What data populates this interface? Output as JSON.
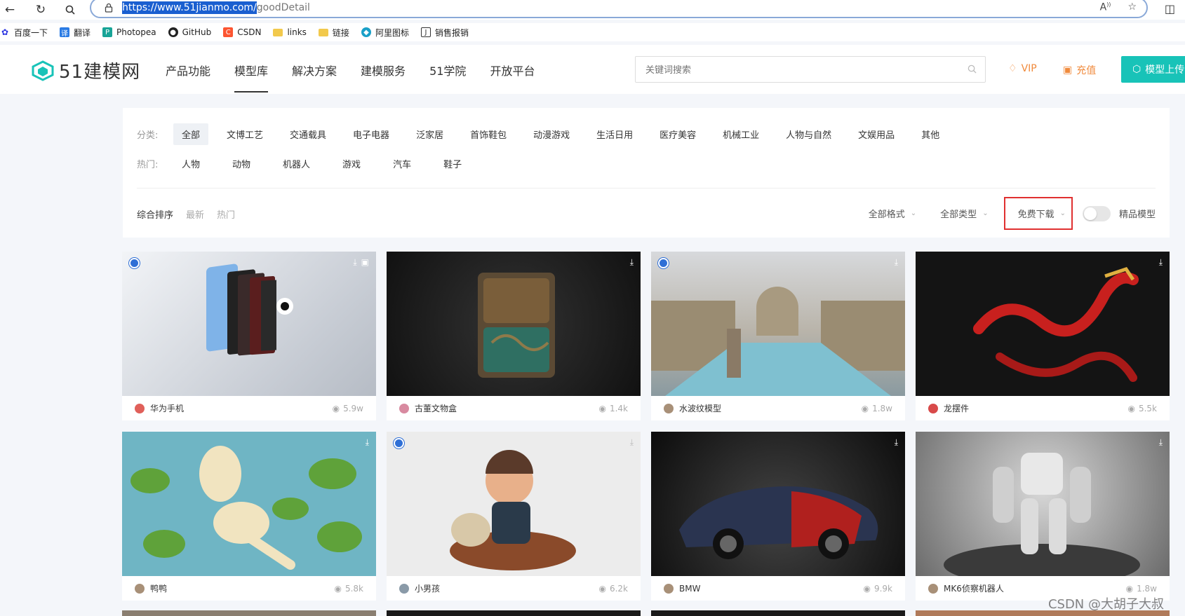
{
  "browser": {
    "url_selected": "https://www.51jianmo.com/",
    "url_rest": "goodDetail",
    "read_aloud": "Aͅ"
  },
  "bookmarks": [
    {
      "label": "百度一下",
      "icon": "paw-icon",
      "color": "#2932e1"
    },
    {
      "label": "翻译",
      "icon": "translate-icon",
      "color": "#2a7be4"
    },
    {
      "label": "Photopea",
      "icon": "photopea-icon",
      "color": "#18a497"
    },
    {
      "label": "GitHub",
      "icon": "github-icon",
      "color": "#222222"
    },
    {
      "label": "CSDN",
      "icon": "csdn-icon",
      "color": "#fc5531"
    },
    {
      "label": "links",
      "icon": "folder-icon",
      "color": "#f2c94c"
    },
    {
      "label": "链接",
      "icon": "folder-icon",
      "color": "#f2c94c"
    },
    {
      "label": "阿里图标",
      "icon": "iconfont-icon",
      "color": "#1aa0c8"
    },
    {
      "label": "销售报销",
      "icon": "j-icon",
      "color": "#333333"
    }
  ],
  "header": {
    "logo_text": "51建模网",
    "nav": [
      "产品功能",
      "模型库",
      "解决方案",
      "建模服务",
      "51学院",
      "开放平台"
    ],
    "active_nav": "模型库",
    "search_placeholder": "关键词搜索",
    "vip_label": "VIP",
    "recharge_label": "充值",
    "upload_label": "模型上传",
    "accent": "#18c3b8",
    "orange": "#f08a3c"
  },
  "filters": {
    "category_label": "分类:",
    "categories": [
      "全部",
      "文博工艺",
      "交通载具",
      "电子电器",
      "泛家居",
      "首饰鞋包",
      "动漫游戏",
      "生活日用",
      "医疗美容",
      "机械工业",
      "人物与自然",
      "文娱用品",
      "其他"
    ],
    "hot_label": "热门:",
    "hot": [
      "人物",
      "动物",
      "机器人",
      "游戏",
      "汽车",
      "鞋子"
    ],
    "sort": [
      "综合排序",
      "最新",
      "热门"
    ],
    "format_dd": "全部格式",
    "type_dd": "全部类型",
    "download_dd": "免费下载",
    "premium_label": "精品模型"
  },
  "cards": [
    {
      "title": "华为手机",
      "views": "5.9w",
      "badge": true,
      "author_color": "#e0605a"
    },
    {
      "title": "古董文物盒",
      "views": "1.4k",
      "badge": false,
      "author_color": "#d88aa0"
    },
    {
      "title": "水波纹模型",
      "views": "1.8w",
      "badge": true,
      "author_color": "#a89078"
    },
    {
      "title": "龙摆件",
      "views": "5.5k",
      "badge": false,
      "author_color": "#d84a4a"
    },
    {
      "title": "鸭鸭",
      "views": "5.8k",
      "badge": false,
      "author_color": "#a89078"
    },
    {
      "title": "小男孩",
      "views": "6.2k",
      "badge": true,
      "author_color": "#8a9aa8"
    },
    {
      "title": "BMW",
      "views": "9.9k",
      "badge": false,
      "author_color": "#a89078"
    },
    {
      "title": "MK6侦察机器人",
      "views": "1.8w",
      "badge": false,
      "author_color": "#a89078"
    }
  ],
  "watermark": "CSDN @大胡子大叔"
}
